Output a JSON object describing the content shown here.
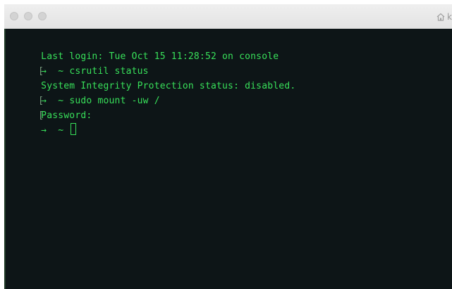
{
  "window": {
    "title_fragment": "k"
  },
  "terminal": {
    "colors": {
      "background": "#0d1517",
      "text": "#38e05a"
    },
    "lines": [
      {
        "bracket": false,
        "prompt": false,
        "text": "Last login: Tue Oct 15 11:28:52 on console"
      },
      {
        "bracket": true,
        "prompt": true,
        "arrow": "→",
        "tilde": "~",
        "text": "csrutil status"
      },
      {
        "bracket": false,
        "prompt": false,
        "text": "System Integrity Protection status: disabled."
      },
      {
        "bracket": true,
        "prompt": true,
        "arrow": "→",
        "tilde": "~",
        "text": "sudo mount -uw /"
      },
      {
        "bracket": true,
        "prompt": false,
        "text": "Password:"
      }
    ],
    "current_prompt": {
      "arrow": "→",
      "tilde": "~",
      "text": ""
    }
  }
}
